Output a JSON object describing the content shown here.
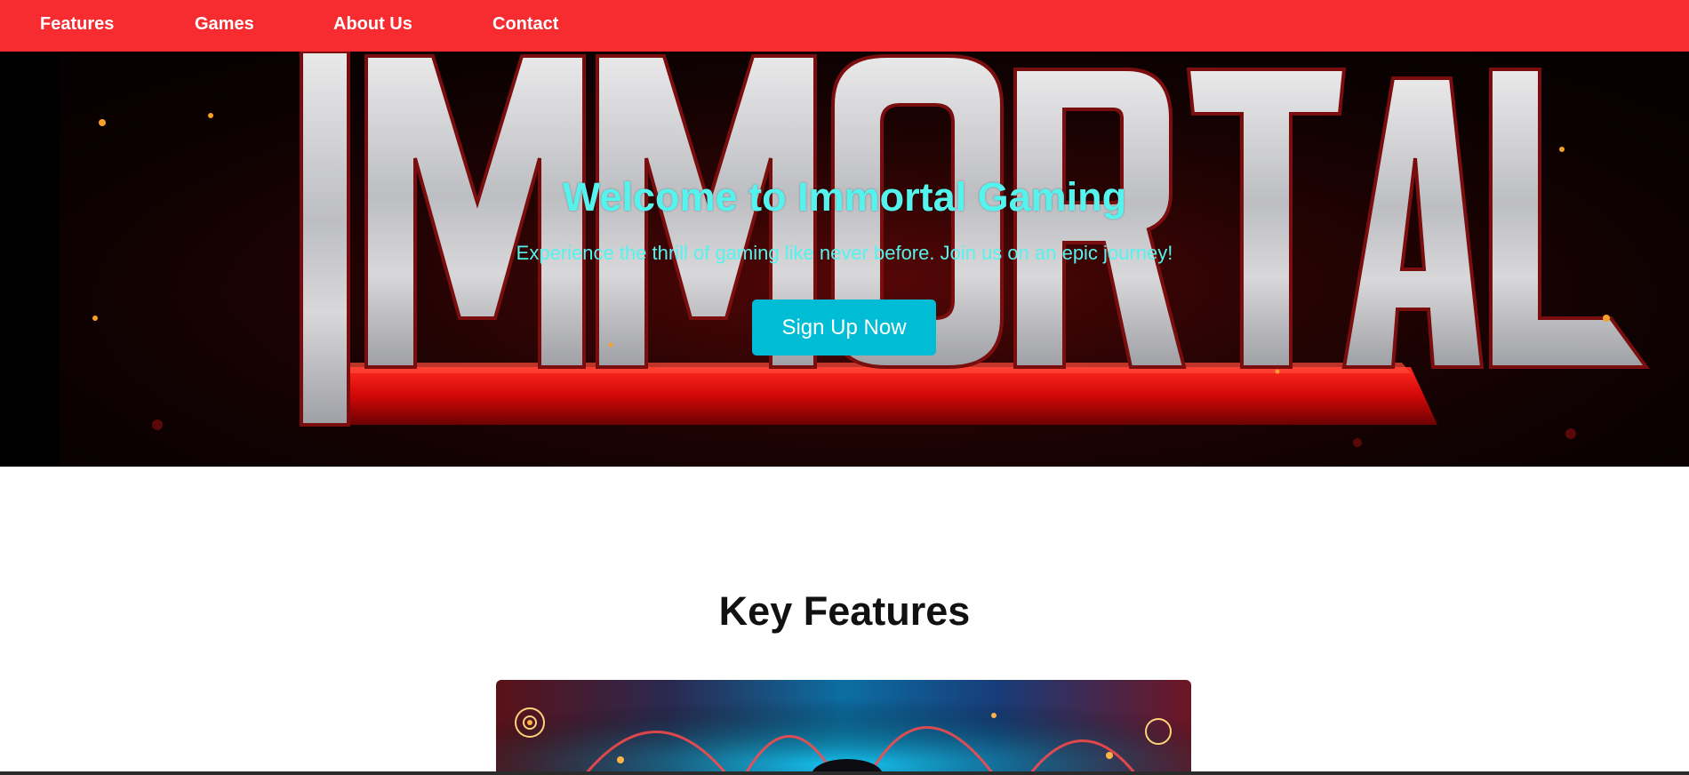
{
  "nav": {
    "items": [
      {
        "label": "Features"
      },
      {
        "label": "Games"
      },
      {
        "label": "About Us"
      },
      {
        "label": "Contact"
      }
    ]
  },
  "hero": {
    "logo_text": "IMMORTAL",
    "title": "Welcome to Immortal Gaming",
    "subtitle": "Experience the thrill of gaming like never before. Join us on an epic journey!",
    "cta_label": "Sign Up Now"
  },
  "features": {
    "heading": "Key Features"
  },
  "colors": {
    "nav_bg": "#f62c31",
    "hero_text": "#55f3ee",
    "cta_bg": "#00bcd4",
    "heading": "#111111"
  }
}
